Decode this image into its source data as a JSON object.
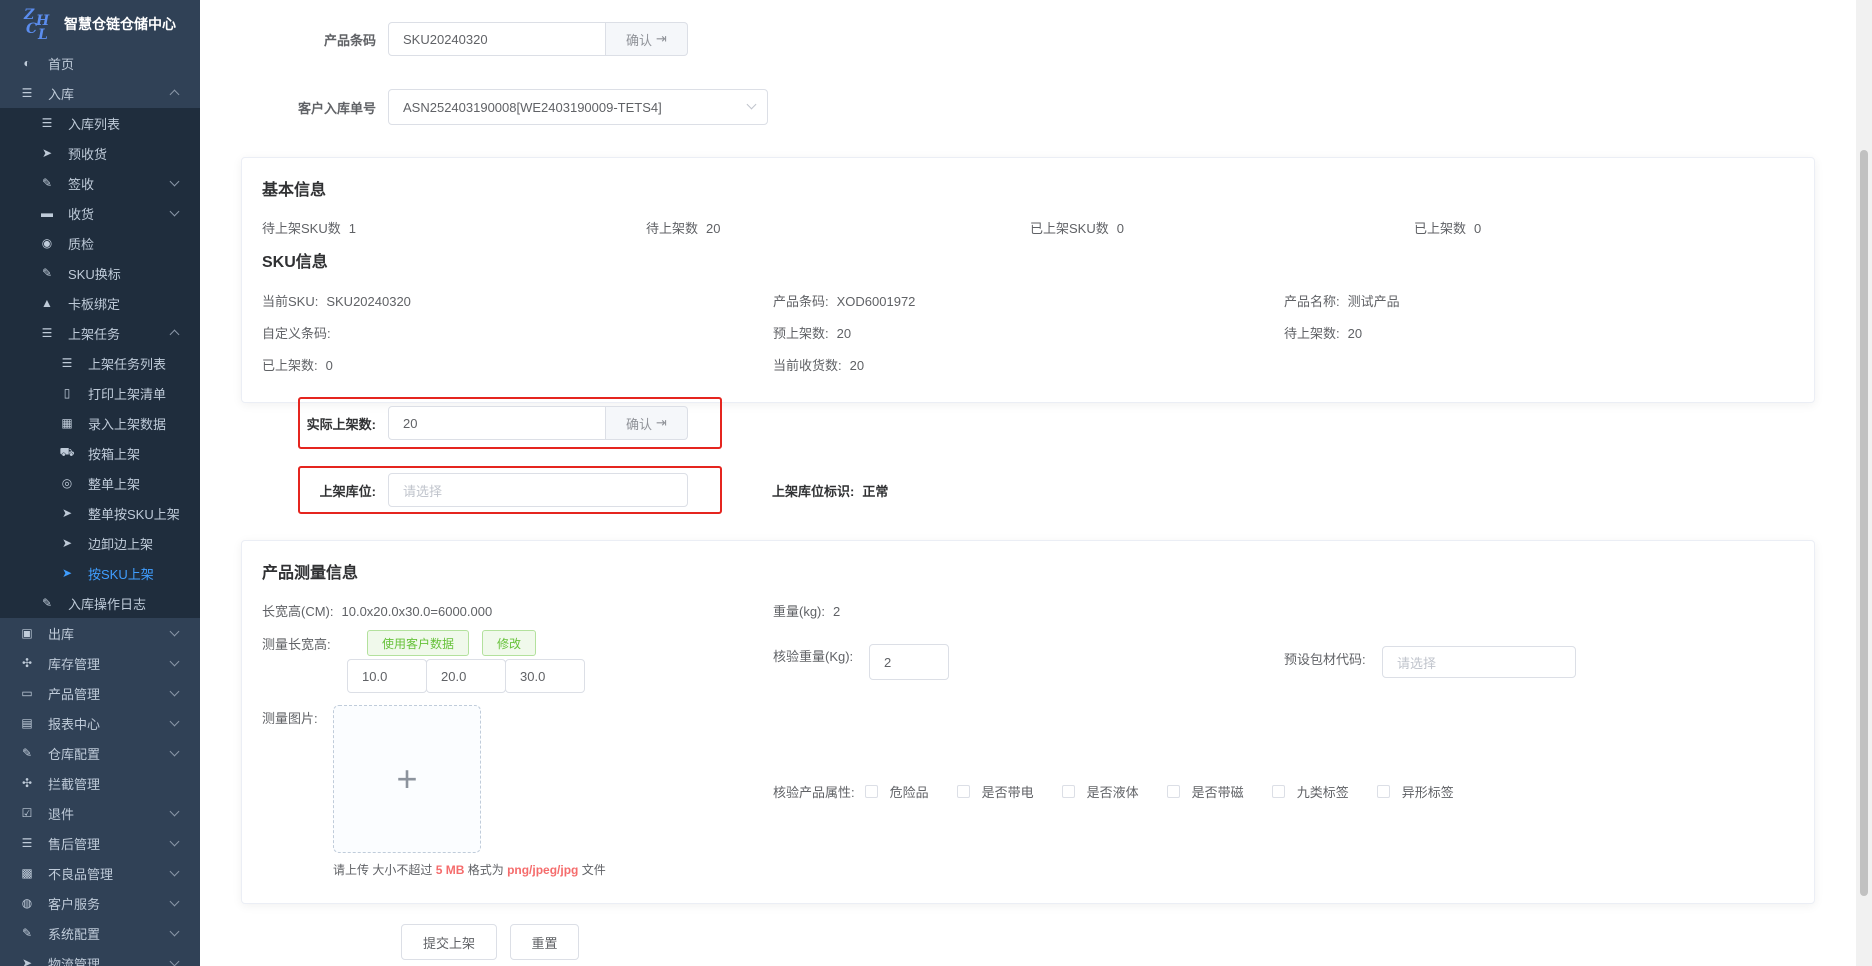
{
  "app": {
    "logo_letters": [
      "Z",
      "H",
      "C",
      "L"
    ],
    "title": "智慧仓链仓储中心"
  },
  "sidebar": {
    "items": [
      {
        "label": "首页",
        "level": 1,
        "icon": "dashboard-icon"
      },
      {
        "label": "入库",
        "level": 1,
        "icon": "list-icon",
        "chev": "up"
      },
      {
        "label": "入库列表",
        "level": 2,
        "icon": "list-icon"
      },
      {
        "label": "预收货",
        "level": 2,
        "icon": "send-icon"
      },
      {
        "label": "签收",
        "level": 2,
        "icon": "edit-icon",
        "chev": "down"
      },
      {
        "label": "收货",
        "level": 2,
        "icon": "clapper-icon",
        "chev": "down"
      },
      {
        "label": "质检",
        "level": 2,
        "icon": "eye-icon"
      },
      {
        "label": "SKU换标",
        "level": 2,
        "icon": "edit-icon"
      },
      {
        "label": "卡板绑定",
        "level": 2,
        "icon": "lock-icon"
      },
      {
        "label": "上架任务",
        "level": 2,
        "icon": "list-icon",
        "chev": "up"
      },
      {
        "label": "上架任务列表",
        "level": 3,
        "icon": "list-icon"
      },
      {
        "label": "打印上架清单",
        "level": 3,
        "icon": "book-icon"
      },
      {
        "label": "录入上架数据",
        "level": 3,
        "icon": "table-icon"
      },
      {
        "label": "按箱上架",
        "level": 3,
        "icon": "cart-icon"
      },
      {
        "label": "整单上架",
        "level": 3,
        "icon": "radio-icon"
      },
      {
        "label": "整单按SKU上架",
        "level": 3,
        "icon": "send-icon"
      },
      {
        "label": "边卸边上架",
        "level": 3,
        "icon": "send-icon"
      },
      {
        "label": "按SKU上架",
        "level": 3,
        "icon": "send-icon",
        "active": true
      },
      {
        "label": "入库操作日志",
        "level": 2,
        "icon": "edit-icon"
      },
      {
        "label": "出库",
        "level": 1,
        "icon": "truck-icon",
        "chev": "down"
      },
      {
        "label": "库存管理",
        "level": 1,
        "icon": "tool-icon",
        "chev": "down"
      },
      {
        "label": "产品管理",
        "level": 1,
        "icon": "box-icon",
        "chev": "down"
      },
      {
        "label": "报表中心",
        "level": 1,
        "icon": "report-icon",
        "chev": "down"
      },
      {
        "label": "仓库配置",
        "level": 1,
        "icon": "edit-icon",
        "chev": "down"
      },
      {
        "label": "拦截管理",
        "level": 1,
        "icon": "tool-icon"
      },
      {
        "label": "退件",
        "level": 1,
        "icon": "checkbox-icon",
        "chev": "down"
      },
      {
        "label": "售后管理",
        "level": 1,
        "icon": "list-icon",
        "chev": "down"
      },
      {
        "label": "不良品管理",
        "level": 1,
        "icon": "printer-icon",
        "chev": "down"
      },
      {
        "label": "客户服务",
        "level": 1,
        "icon": "user-icon",
        "chev": "down"
      },
      {
        "label": "系统配置",
        "level": 1,
        "icon": "edit-icon",
        "chev": "down"
      },
      {
        "label": "物流管理",
        "level": 1,
        "icon": "send-icon",
        "chev": "down"
      }
    ]
  },
  "form": {
    "barcode_label": "产品条码",
    "barcode_value": "SKU20240320",
    "confirm_label": "确认",
    "asn_label": "客户入库单号",
    "asn_value": "ASN252403190008[WE2403190009-TETS4]"
  },
  "basic_info": {
    "title": "基本信息",
    "pending_sku_label": "待上架SKU数",
    "pending_sku_value": "1",
    "pending_qty_label": "待上架数",
    "pending_qty_value": "20",
    "shelved_sku_label": "已上架SKU数",
    "shelved_sku_value": "0",
    "shelved_qty_label": "已上架数",
    "shelved_qty_value": "0"
  },
  "sku_info": {
    "title": "SKU信息",
    "current_sku_label": "当前SKU:",
    "current_sku_value": "SKU20240320",
    "product_barcode_label": "产品条码:",
    "product_barcode_value": "XOD6001972",
    "product_name_label": "产品名称:",
    "product_name_value": "测试产品",
    "custom_barcode_label": "自定义条码:",
    "custom_barcode_value": "",
    "pre_shelf_label": "预上架数:",
    "pre_shelf_value": "20",
    "pending_label": "待上架数:",
    "pending_value": "20",
    "shelved_label": "已上架数:",
    "shelved_value": "0",
    "received_label": "当前收货数:",
    "received_value": "20"
  },
  "shelving": {
    "actual_label": "实际上架数:",
    "actual_value": "20",
    "confirm_label": "确认",
    "location_label": "上架库位:",
    "location_placeholder": "请选择",
    "location_flag_label": "上架库位标识:",
    "location_flag_value": "正常"
  },
  "measure": {
    "title": "产品测量信息",
    "dims_label": "长宽高(CM):",
    "dims_value": "10.0x20.0x30.0=6000.000",
    "weight_label": "重量(kg):",
    "weight_value": "2",
    "measure_dims_label": "测量长宽高:",
    "use_customer_btn": "使用客户数据",
    "modify_btn": "修改",
    "length": "10.0",
    "width": "20.0",
    "height": "30.0",
    "check_weight_label": "核验重量(Kg):",
    "check_weight_value": "2",
    "package_code_label": "预设包材代码:",
    "package_code_placeholder": "请选择",
    "photo_label": "测量图片:",
    "upload_tip_prefix": "请上传 大小不超过",
    "upload_tip_size": "5 MB",
    "upload_tip_mid": "格式为",
    "upload_tip_formats": "png/jpeg/jpg",
    "upload_tip_suffix": "文件",
    "attr_label": "核验产品属性:",
    "attrs": [
      "危险品",
      "是否带电",
      "是否液体",
      "是否带磁",
      "九类标签",
      "异形标签"
    ]
  },
  "actions": {
    "submit": "提交上架",
    "reset": "重置"
  },
  "colors": {
    "sidebar_bg": "#304156",
    "active": "#409eff",
    "highlight_box": "#e5251f"
  }
}
